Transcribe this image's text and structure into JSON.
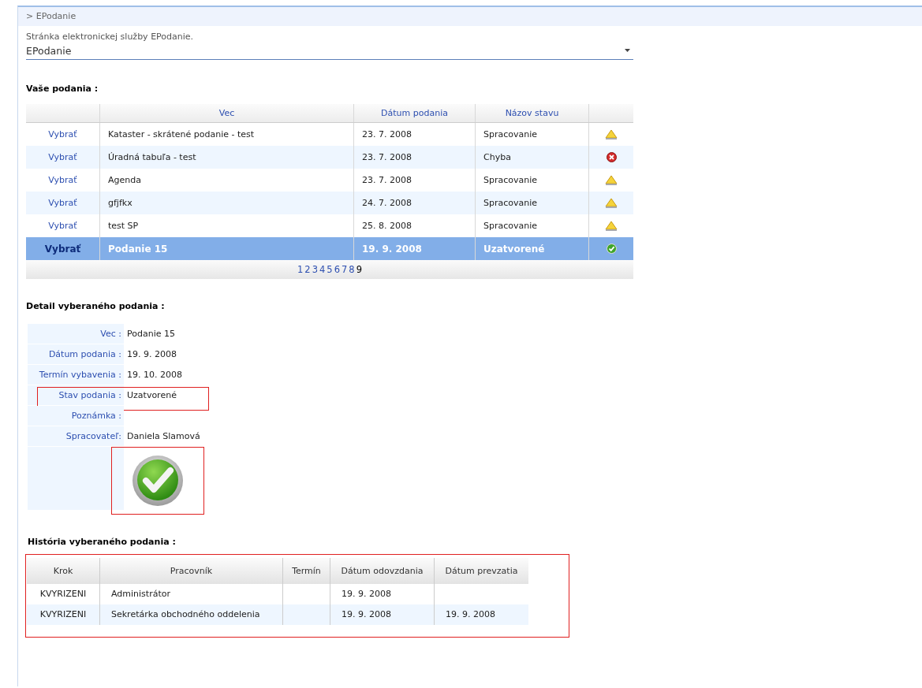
{
  "breadcrumb": "> EPodanie",
  "description": "Stránka elektronickej služby EPodanie.",
  "service_select": {
    "value": "EPodanie"
  },
  "submissions": {
    "title": "Vaše podania :",
    "columns": [
      "Vec",
      "Dátum podania",
      "Názov stavu"
    ],
    "rows": [
      {
        "action": "Vybrať",
        "subject": "Kataster - skrátené podanie - test",
        "date": "23. 7. 2008",
        "status": "Spracovanie",
        "kind": "warning",
        "selected": false
      },
      {
        "action": "Vybrať",
        "subject": "Úradná tabuľa - test",
        "date": "23. 7. 2008",
        "status": "Chyba",
        "kind": "error",
        "selected": false
      },
      {
        "action": "Vybrať",
        "subject": "Agenda",
        "date": "23. 7. 2008",
        "status": "Spracovanie",
        "kind": "warning",
        "selected": false
      },
      {
        "action": "Vybrať",
        "subject": "gfjfkx",
        "date": "24. 7. 2008",
        "status": "Spracovanie",
        "kind": "warning",
        "selected": false
      },
      {
        "action": "Vybrať",
        "subject": "test SP",
        "date": "25. 8. 2008",
        "status": "Spracovanie",
        "kind": "warning",
        "selected": false
      },
      {
        "action": "Vybrať",
        "subject": "Podanie 15",
        "date": "19. 9. 2008",
        "status": "Uzatvorené",
        "kind": "ok",
        "selected": true
      }
    ],
    "pages": [
      {
        "label": "1",
        "selected": false
      },
      {
        "label": "2",
        "selected": false
      },
      {
        "label": "3",
        "selected": false
      },
      {
        "label": "4",
        "selected": false
      },
      {
        "label": "5",
        "selected": false
      },
      {
        "label": "6",
        "selected": false
      },
      {
        "label": "7",
        "selected": false
      },
      {
        "label": "8",
        "selected": false
      },
      {
        "label": "9",
        "selected": true
      }
    ]
  },
  "detail": {
    "title": "Detail vyberaného podania :",
    "fields": [
      {
        "label": "Vec :",
        "value": "Podanie 15",
        "highlighted": false
      },
      {
        "label": "Dátum podania :",
        "value": "19. 9. 2008",
        "highlighted": false
      },
      {
        "label": "Termín vybavenia :",
        "value": "19. 10. 2008",
        "highlighted": false
      },
      {
        "label": "Stav podania :",
        "value": "Uzatvorené",
        "highlighted": true
      },
      {
        "label": "Poznámka :",
        "highlighted": false
      },
      {
        "label": "Spracovateľ:",
        "value": "Daniela Slamová",
        "highlighted": false
      }
    ],
    "status_image": {
      "kind": "ok",
      "highlighted": true
    }
  },
  "history": {
    "title": "História vyberaného podania :",
    "highlighted": true,
    "columns": [
      "Krok",
      "Pracovník",
      "Termín",
      "Dátum odovzdania",
      "Dátum prevzatia"
    ],
    "rows": [
      [
        "KVYRIZENI",
        "Administrátor",
        "",
        "19. 9. 2008",
        ""
      ],
      [
        "KVYRIZENI",
        "Sekretárka obchodného oddelenia",
        "",
        "19. 9. 2008",
        "19. 9. 2008"
      ]
    ]
  }
}
